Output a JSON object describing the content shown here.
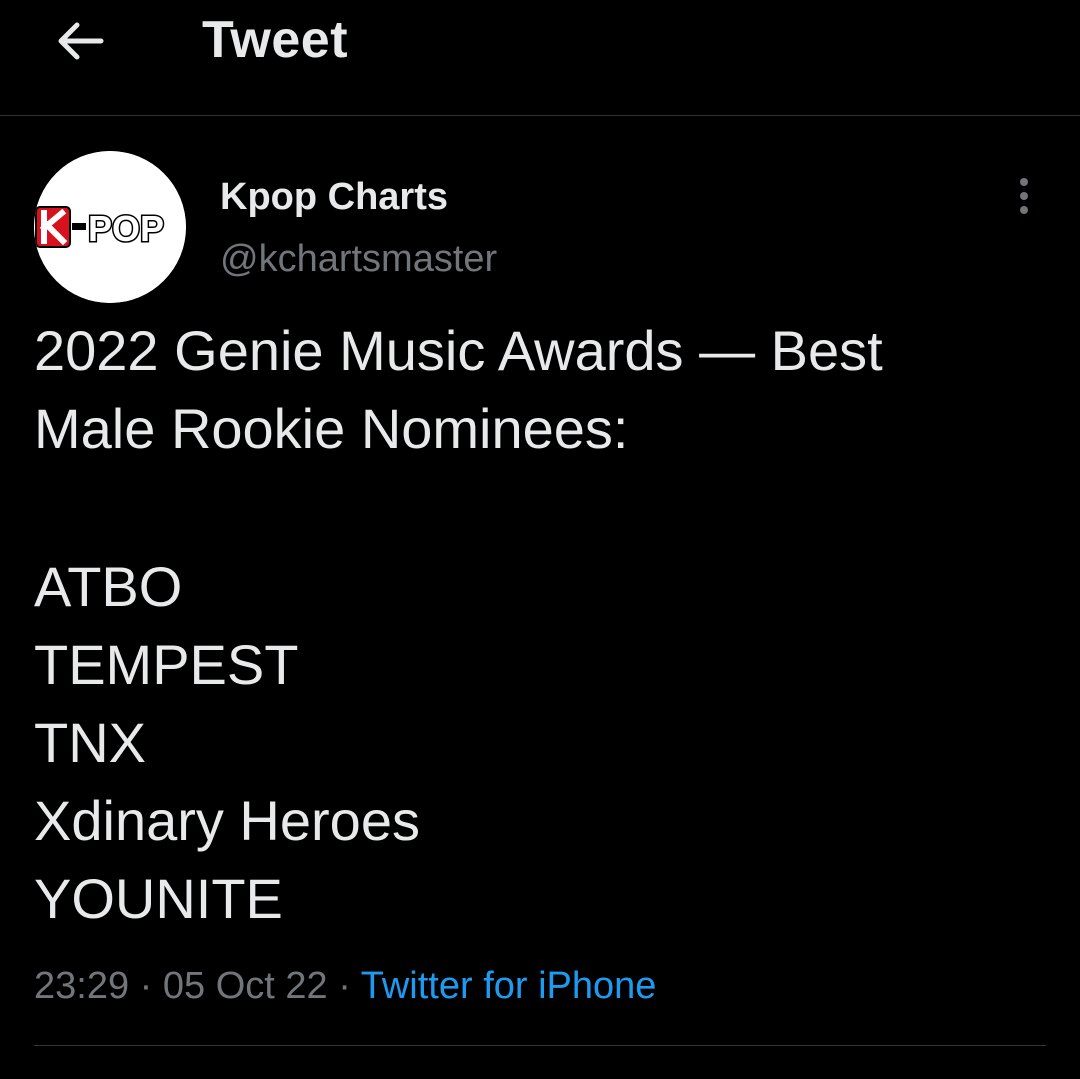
{
  "header": {
    "title": "Tweet",
    "back_icon": "arrow-left-icon"
  },
  "author": {
    "name": "Kpop Charts",
    "handle": "@kchartsmaster",
    "avatar_logo_text": "K-POP"
  },
  "tweet": {
    "line1": "2022 Genie Music Awards — Best",
    "line2": "Male Rookie Nominees:",
    "nominees": [
      "ATBO",
      "TEMPEST",
      "TNX",
      "Xdinary Heroes",
      "YOUNITE"
    ]
  },
  "meta": {
    "time": "23:29",
    "separator": "·",
    "date": "05 Oct 22",
    "source": "Twitter for iPhone"
  },
  "colors": {
    "background": "#000000",
    "text": "#e7e9ea",
    "secondary": "#71767b",
    "accent": "#1d9bf0",
    "border": "#2f3336"
  }
}
